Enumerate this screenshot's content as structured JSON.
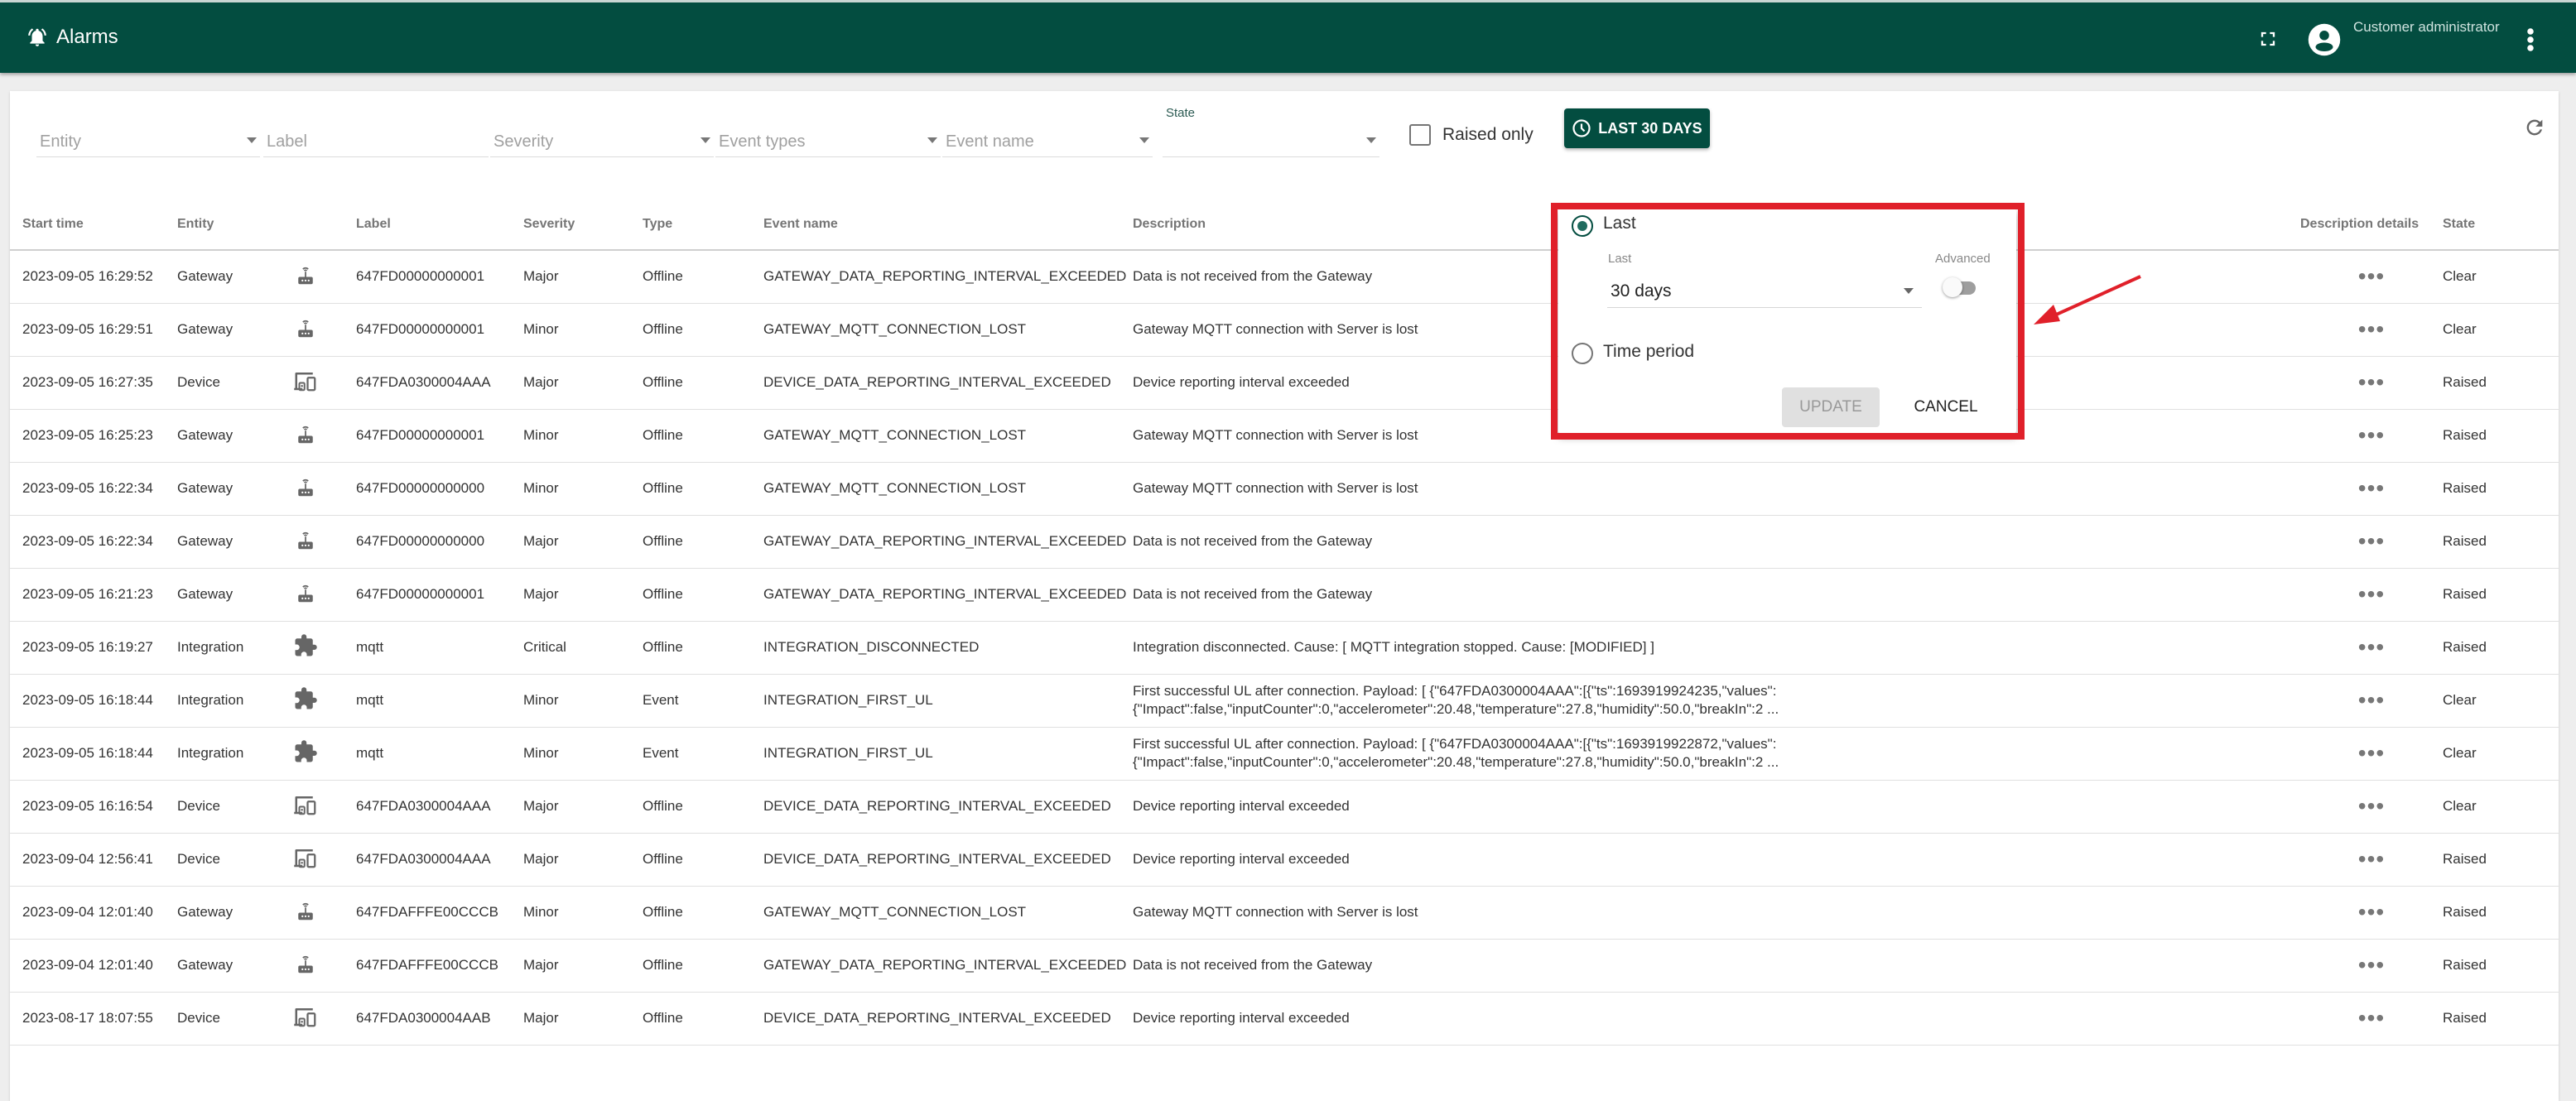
{
  "header": {
    "title": "Alarms",
    "title_icon": "bell-ring-icon",
    "user_name": "Customer administrator",
    "icons": [
      "fullscreen-icon",
      "account-circle-icon",
      "more-vert-icon"
    ]
  },
  "filters": {
    "entity_placeholder": "Entity",
    "label_placeholder": "Label",
    "severity_placeholder": "Severity",
    "event_types_placeholder": "Event types",
    "event_name_placeholder": "Event name",
    "state_label": "State",
    "state_value": "",
    "raised_only_label": "Raised only",
    "raised_only_checked": false,
    "time_range_button": "LAST 30 DAYS",
    "refresh_icon": "refresh-icon"
  },
  "table": {
    "columns": [
      "Start time",
      "Entity",
      "",
      "Label",
      "Severity",
      "Type",
      "Event name",
      "Description",
      "Description details",
      "State"
    ],
    "rows": [
      {
        "start_time": "2023-09-05 16:29:52",
        "entity": "Gateway",
        "icon": "router-icon",
        "label": "647FD00000000001",
        "severity": "Major",
        "type": "Offline",
        "event_name": "GATEWAY_DATA_REPORTING_INTERVAL_EXCEEDED",
        "description": "Data is not received from the Gateway",
        "description2": "",
        "state": "Clear"
      },
      {
        "start_time": "2023-09-05 16:29:51",
        "entity": "Gateway",
        "icon": "router-icon",
        "label": "647FD00000000001",
        "severity": "Minor",
        "type": "Offline",
        "event_name": "GATEWAY_MQTT_CONNECTION_LOST",
        "description": "Gateway MQTT connection with Server is lost",
        "description2": "",
        "state": "Clear"
      },
      {
        "start_time": "2023-09-05 16:27:35",
        "entity": "Device",
        "icon": "devices-icon",
        "label": "647FDA0300004AAA",
        "severity": "Major",
        "type": "Offline",
        "event_name": "DEVICE_DATA_REPORTING_INTERVAL_EXCEEDED",
        "description": "Device reporting interval exceeded",
        "description2": "",
        "state": "Raised"
      },
      {
        "start_time": "2023-09-05 16:25:23",
        "entity": "Gateway",
        "icon": "router-icon",
        "label": "647FD00000000001",
        "severity": "Minor",
        "type": "Offline",
        "event_name": "GATEWAY_MQTT_CONNECTION_LOST",
        "description": "Gateway MQTT connection with Server is lost",
        "description2": "",
        "state": "Raised"
      },
      {
        "start_time": "2023-09-05 16:22:34",
        "entity": "Gateway",
        "icon": "router-icon",
        "label": "647FD00000000000",
        "severity": "Minor",
        "type": "Offline",
        "event_name": "GATEWAY_MQTT_CONNECTION_LOST",
        "description": "Gateway MQTT connection with Server is lost",
        "description2": "",
        "state": "Raised"
      },
      {
        "start_time": "2023-09-05 16:22:34",
        "entity": "Gateway",
        "icon": "router-icon",
        "label": "647FD00000000000",
        "severity": "Major",
        "type": "Offline",
        "event_name": "GATEWAY_DATA_REPORTING_INTERVAL_EXCEEDED",
        "description": "Data is not received from the Gateway",
        "description2": "",
        "state": "Raised"
      },
      {
        "start_time": "2023-09-05 16:21:23",
        "entity": "Gateway",
        "icon": "router-icon",
        "label": "647FD00000000001",
        "severity": "Major",
        "type": "Offline",
        "event_name": "GATEWAY_DATA_REPORTING_INTERVAL_EXCEEDED",
        "description": "Data is not received from the Gateway",
        "description2": "",
        "state": "Raised"
      },
      {
        "start_time": "2023-09-05 16:19:27",
        "entity": "Integration",
        "icon": "puzzle-icon",
        "label": "mqtt",
        "severity": "Critical",
        "type": "Offline",
        "event_name": "INTEGRATION_DISCONNECTED",
        "description": "Integration disconnected. Cause: [ MQTT integration stopped. Cause: [MODIFIED] ]",
        "description2": "",
        "state": "Raised"
      },
      {
        "start_time": "2023-09-05 16:18:44",
        "entity": "Integration",
        "icon": "puzzle-icon",
        "label": "mqtt",
        "severity": "Minor",
        "type": "Event",
        "event_name": "INTEGRATION_FIRST_UL",
        "description": "First successful UL after connection. Payload: [ {\"647FDA0300004AAA\":[{\"ts\":1693919924235,\"values\":",
        "description2": "{\"Impact\":false,\"inputCounter\":0,\"accelerometer\":20.48,\"temperature\":27.8,\"humidity\":50.0,\"breakIn\":2 ...",
        "state": "Clear"
      },
      {
        "start_time": "2023-09-05 16:18:44",
        "entity": "Integration",
        "icon": "puzzle-icon",
        "label": "mqtt",
        "severity": "Minor",
        "type": "Event",
        "event_name": "INTEGRATION_FIRST_UL",
        "description": "First successful UL after connection. Payload: [ {\"647FDA0300004AAA\":[{\"ts\":1693919922872,\"values\":",
        "description2": "{\"Impact\":false,\"inputCounter\":0,\"accelerometer\":20.48,\"temperature\":27.8,\"humidity\":50.0,\"breakIn\":2 ...",
        "state": "Clear"
      },
      {
        "start_time": "2023-09-05 16:16:54",
        "entity": "Device",
        "icon": "devices-icon",
        "label": "647FDA0300004AAA",
        "severity": "Major",
        "type": "Offline",
        "event_name": "DEVICE_DATA_REPORTING_INTERVAL_EXCEEDED",
        "description": "Device reporting interval exceeded",
        "description2": "",
        "state": "Clear"
      },
      {
        "start_time": "2023-09-04 12:56:41",
        "entity": "Device",
        "icon": "devices-icon",
        "label": "647FDA0300004AAA",
        "severity": "Major",
        "type": "Offline",
        "event_name": "DEVICE_DATA_REPORTING_INTERVAL_EXCEEDED",
        "description": "Device reporting interval exceeded",
        "description2": "",
        "state": "Raised"
      },
      {
        "start_time": "2023-09-04 12:01:40",
        "entity": "Gateway",
        "icon": "router-icon",
        "label": "647FDAFFFE00CCCB",
        "severity": "Minor",
        "type": "Offline",
        "event_name": "GATEWAY_MQTT_CONNECTION_LOST",
        "description": "Gateway MQTT connection with Server is lost",
        "description2": "",
        "state": "Raised"
      },
      {
        "start_time": "2023-09-04 12:01:40",
        "entity": "Gateway",
        "icon": "router-icon",
        "label": "647FDAFFFE00CCCB",
        "severity": "Major",
        "type": "Offline",
        "event_name": "GATEWAY_DATA_REPORTING_INTERVAL_EXCEEDED",
        "description": "Data is not received from the Gateway",
        "description2": "",
        "state": "Raised"
      },
      {
        "start_time": "2023-08-17 18:07:55",
        "entity": "Device",
        "icon": "devices-icon",
        "label": "647FDA0300004AAB",
        "severity": "Major",
        "type": "Offline",
        "event_name": "DEVICE_DATA_REPORTING_INTERVAL_EXCEEDED",
        "description": "Device reporting interval exceeded",
        "description2": "",
        "state": "Raised"
      }
    ],
    "details_glyph": "•••"
  },
  "time_popup": {
    "option_last_label": "Last",
    "option_last_selected": true,
    "last_field_label": "Last",
    "last_value": "30 days",
    "advanced_label": "Advanced",
    "advanced_enabled": false,
    "option_period_label": "Time period",
    "option_period_selected": false,
    "update_label": "UPDATE",
    "cancel_label": "CANCEL"
  },
  "annotation": {
    "highlight_color": "#e0202a",
    "arrow_color": "#e0202a"
  },
  "colors": {
    "primary": "#034d40",
    "highlight": "#e0202a"
  }
}
